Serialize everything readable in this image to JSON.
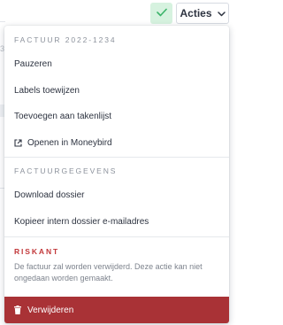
{
  "toolbar": {
    "actions_label": "Acties"
  },
  "backdrop": {
    "fragment": "3"
  },
  "menu": {
    "invoice_section_title": "FACTUUR 2022-1234",
    "invoice_items": [
      {
        "label": "Pauzeren"
      },
      {
        "label": "Labels toewijzen"
      },
      {
        "label": "Toevoegen aan takenlijst"
      },
      {
        "label": "Openen in Moneybird",
        "icon": "external-link-icon"
      }
    ],
    "details_section_title": "FACTUURGEGEVENS",
    "details_items": [
      {
        "label": "Download dossier"
      },
      {
        "label": "Kopieer intern dossier e-mailadres"
      }
    ],
    "danger_section_title": "RISKANT",
    "danger_description": "De factuur zal worden verwijderd. Deze actie kan niet ongedaan worden gemaakt.",
    "delete_label": "Verwijderen",
    "delete_icon": "trash-icon"
  },
  "colors": {
    "approve_bg": "#d6f2df",
    "approve_check": "#3bb46a",
    "danger_text": "#c2383a",
    "danger_button": "#a93236"
  }
}
